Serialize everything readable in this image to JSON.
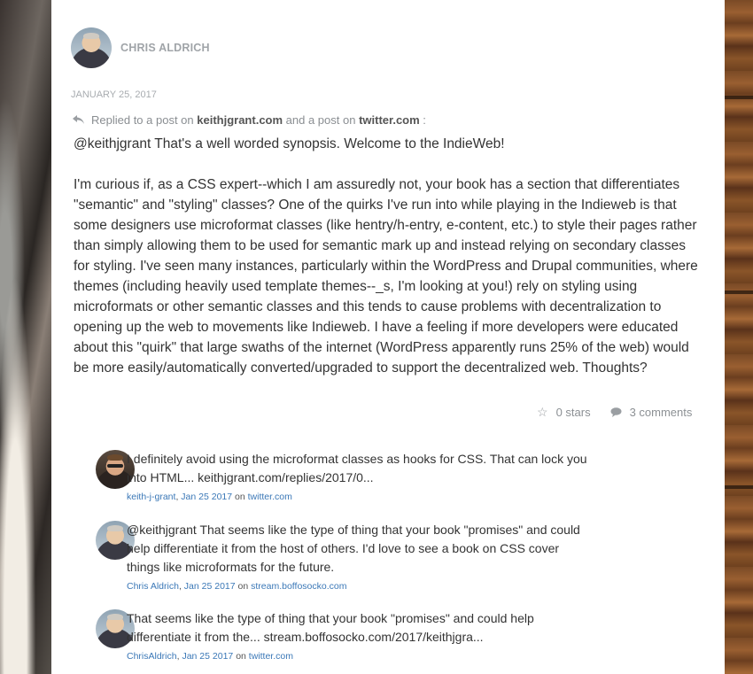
{
  "post": {
    "author": "CHRIS ALDRICH",
    "date": "JANUARY 25, 2017",
    "reply": {
      "prefix": "Replied to a post on ",
      "site1": "keithjgrant.com",
      "middle": " and a post on ",
      "site2": "twitter.com",
      "suffix": " :"
    },
    "paragraphs": [
      "@keithjgrant That's a well worded synopsis. Welcome to the IndieWeb!",
      "I'm curious if, as a CSS expert--which I am assuredly not, your book has a section that differentiates \"semantic\" and \"styling\" classes? One of the quirks I've run into while playing in the Indieweb is that some designers use microformat classes (like hentry/h-entry, e-content, etc.) to style their pages rather than simply allowing them to be used for semantic mark up and instead relying on secondary classes for styling. I've seen many instances, particularly within the WordPress and Drupal communities, where themes (including heavily used template themes--_s, I'm looking at you!) rely on styling using microformats or other semantic classes and this tends to cause problems with decentralization to opening up the web to movements like Indieweb. I have a feeling if more developers were educated about this \"quirk\" that large swaths of the internet (WordPress apparently runs 25% of the web) would be more easily/automatically converted/upgraded to support the decentralized web. Thoughts?"
    ],
    "stars": "0 stars",
    "comments_count": "3 comments"
  },
  "comments": [
    {
      "text": "I definitely avoid using the microformat classes as hooks for CSS. That can lock you into HTML... keithjgrant.com/replies/2017/0...",
      "author": "keith-j-grant",
      "date": "Jan 25 2017",
      "on": "on",
      "source": "twitter.com"
    },
    {
      "text": "@keithjgrant That seems like the type of thing that your book \"promises\" and could help differentiate it from the host of others. I'd love to see a book on CSS cover things like microformats for the future.",
      "author": "Chris Aldrich",
      "date": "Jan 25 2017",
      "on": "on",
      "source": "stream.boffosocko.com"
    },
    {
      "text": "That seems like the type of thing that your book \"promises\" and could help differentiate it from the... stream.boffosocko.com/2017/keithjgra...",
      "author": "ChrisAldrich",
      "date": "Jan 25 2017",
      "on": "on",
      "source": "twitter.com"
    }
  ],
  "icons": [
    "reply-icon",
    "star-icon",
    "comment-bubble-icon"
  ],
  "colors": {
    "link": "#3b78b7",
    "text": "#333333",
    "muted": "#a0a4a8"
  }
}
